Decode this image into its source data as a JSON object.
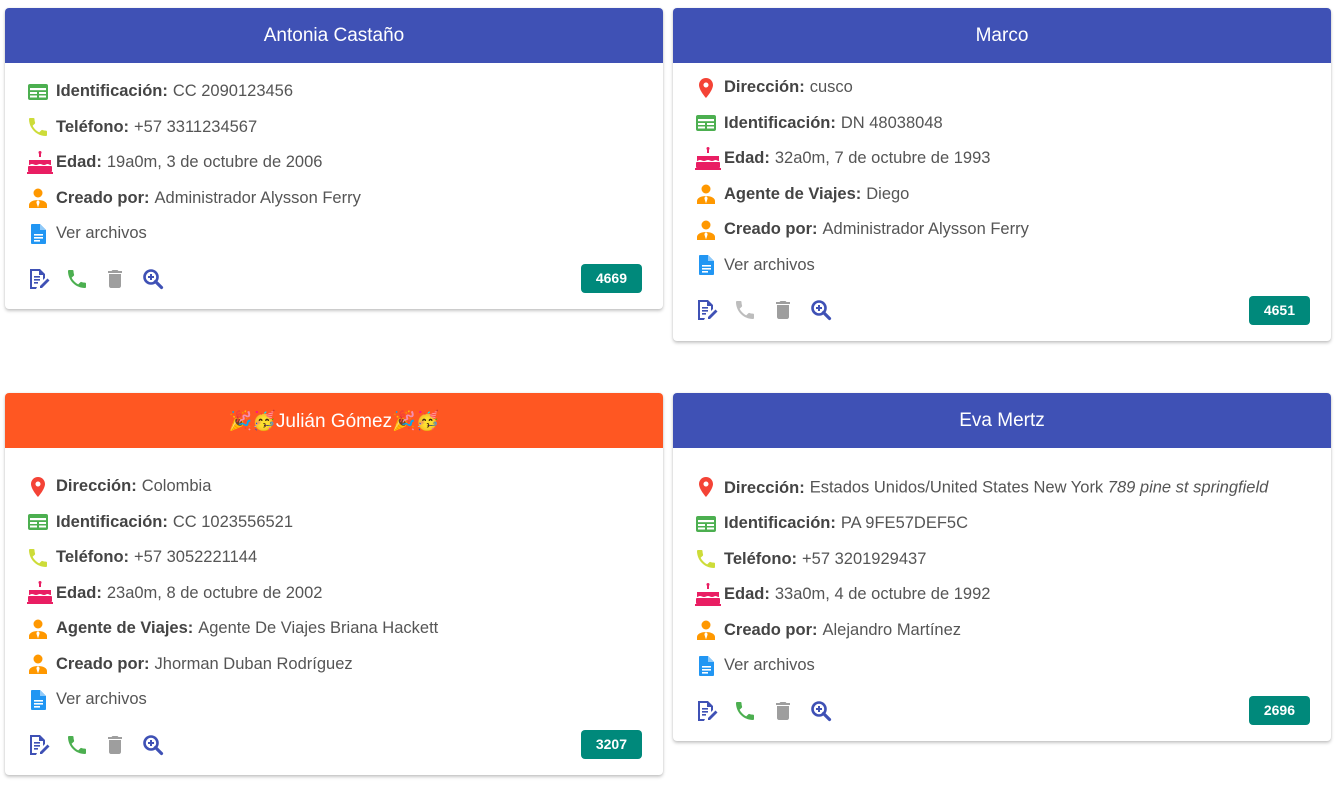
{
  "colors": {
    "header_blue": "#3f51b5",
    "header_orange": "#ff5722",
    "badge_teal": "#00897b",
    "location_red": "#f44336",
    "id_green": "#4caf50",
    "phone_lime": "#cddc39",
    "cake_pink": "#e91e63",
    "agent_orange": "#ff9800",
    "file_blue": "#2196f3",
    "action_indigo": "#3f51b5",
    "action_green": "#4caf50",
    "action_grey": "#9e9e9e",
    "action_disabled": "#bdbdbd"
  },
  "cards": [
    {
      "title": "Antonia Castaño",
      "header_color": "blue",
      "fields": [
        {
          "icon": "id-card-icon",
          "label": "Identificación:",
          "value": "CC 2090123456"
        },
        {
          "icon": "phone-icon",
          "label": "Teléfono:",
          "value": "+57 3311234567"
        },
        {
          "icon": "cake-icon",
          "label": "Edad:",
          "value": "19a0m, 3 de octubre de 2006"
        },
        {
          "icon": "agent-icon",
          "label": "Creado por:",
          "value": "Administrador Alysson Ferry"
        }
      ],
      "files_link": "Ver archivos",
      "phone_enabled": true,
      "badge": "4669"
    },
    {
      "title": "Marco",
      "header_color": "blue",
      "fields": [
        {
          "icon": "location-icon",
          "label": "Dirección:",
          "value": "cusco"
        },
        {
          "icon": "id-card-icon",
          "label": "Identificación:",
          "value": "DN 48038048"
        },
        {
          "icon": "cake-icon",
          "label": "Edad:",
          "value": "32a0m, 7 de octubre de 1993"
        },
        {
          "icon": "agent-icon",
          "label": "Agente de Viajes:",
          "value": "Diego"
        },
        {
          "icon": "agent-icon",
          "label": "Creado por:",
          "value": "Administrador Alysson Ferry"
        }
      ],
      "files_link": "Ver archivos",
      "phone_enabled": false,
      "badge": "4651"
    },
    {
      "title": "🎉🥳Julián Gómez🎉🥳",
      "header_color": "orange",
      "fields": [
        {
          "icon": "location-icon",
          "label": "Dirección:",
          "value": "Colombia"
        },
        {
          "icon": "id-card-icon",
          "label": "Identificación:",
          "value": "CC 1023556521"
        },
        {
          "icon": "phone-icon",
          "label": "Teléfono:",
          "value": "+57 3052221144"
        },
        {
          "icon": "cake-icon",
          "label": "Edad:",
          "value": "23a0m, 8 de octubre de 2002"
        },
        {
          "icon": "agent-icon",
          "label": "Agente de Viajes:",
          "value": "Agente De Viajes Briana Hackett"
        },
        {
          "icon": "agent-icon",
          "label": "Creado por:",
          "value": "Jhorman Duban Rodríguez"
        }
      ],
      "files_link": "Ver archivos",
      "phone_enabled": true,
      "badge": "3207"
    },
    {
      "title": "Eva Mertz",
      "header_color": "blue",
      "fields": [
        {
          "icon": "location-icon",
          "label": "Dirección:",
          "value": "Estados Unidos/United States New York",
          "value_italic": "789 pine st springfield"
        },
        {
          "icon": "id-card-icon",
          "label": "Identificación:",
          "value": "PA 9FE57DEF5C"
        },
        {
          "icon": "phone-icon",
          "label": "Teléfono:",
          "value": "+57 3201929437"
        },
        {
          "icon": "cake-icon",
          "label": "Edad:",
          "value": "33a0m, 4 de octubre de 1992"
        },
        {
          "icon": "agent-icon",
          "label": "Creado por:",
          "value": "Alejandro Martínez"
        }
      ],
      "files_link": "Ver archivos",
      "phone_enabled": true,
      "badge": "2696"
    }
  ]
}
